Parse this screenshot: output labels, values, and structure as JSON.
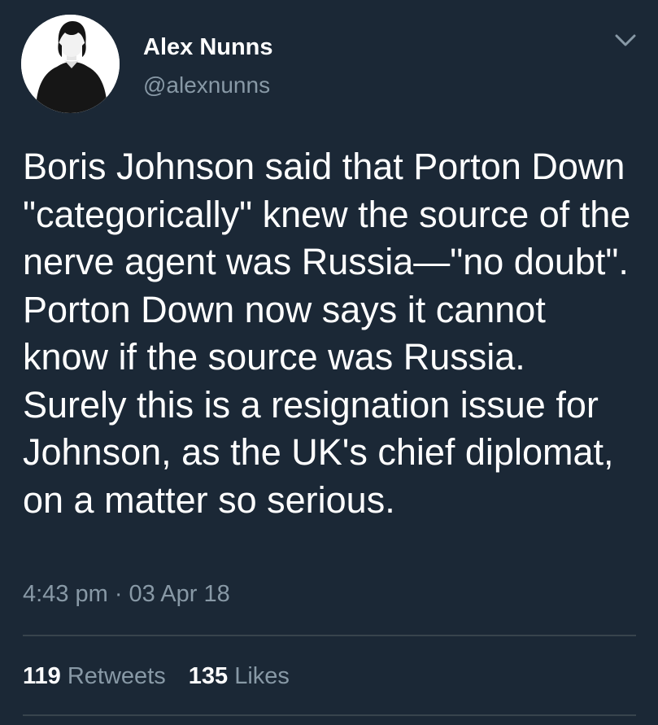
{
  "author": {
    "display_name": "Alex Nunns",
    "handle": "@alexnunns",
    "avatar_icon": "person-avatar"
  },
  "tweet": {
    "text": "Boris Johnson said that Porton Down \"categorically\" knew the source of the nerve agent was Russia—\"no doubt\".\nPorton Down now says it cannot know if the source was Russia.\nSurely this is a resignation issue for Johnson, as the UK's chief diplomat, on a matter so serious.",
    "timestamp": "4:43 pm · 03 Apr 18"
  },
  "stats": {
    "retweets_count": "119",
    "retweets_label": "Retweets",
    "likes_count": "135",
    "likes_label": "Likes"
  },
  "menu_icon": "chevron-down-icon",
  "colors": {
    "background": "#1b2836",
    "primary_text": "#ffffff",
    "secondary_text": "#8899a6",
    "divider": "#38444d"
  }
}
